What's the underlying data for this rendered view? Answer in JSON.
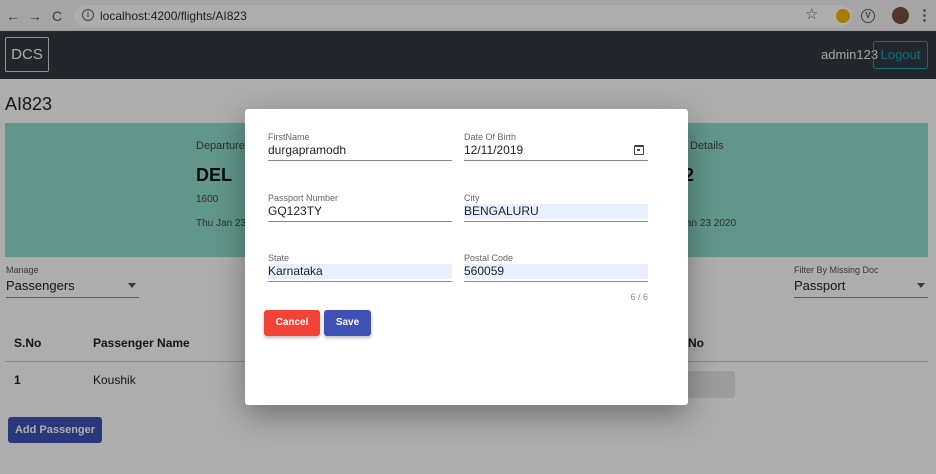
{
  "browser": {
    "url": "localhost:4200/flights/AI823",
    "back_icon": "←",
    "forward_icon": "→",
    "reload_icon": "C",
    "info_icon": "i",
    "star_icon": "☆",
    "ext_icon": "V",
    "menu_icon": "⋮"
  },
  "header": {
    "brand": "DCS",
    "username": "admin123",
    "logout_label": "Logout",
    "background": "#343a40",
    "logout_color": "#17a2b8"
  },
  "page": {
    "flight_title": "AI823",
    "card_color": "#8fdecc",
    "departure": {
      "label": "Departure",
      "code": "DEL",
      "time": "1600",
      "date": "Thu Jan 23"
    },
    "arrival": {
      "label": "Details",
      "code": "2",
      "date": "an 23 2020"
    },
    "manage": {
      "label": "Manage",
      "value": "Passengers"
    },
    "filter": {
      "label": "Filter By Missing Doc",
      "value": "Passport"
    },
    "table": {
      "headers": [
        "S.No",
        "Passenger Name",
        "No"
      ],
      "rows": [
        {
          "sno": "1",
          "name": "Koushik"
        }
      ]
    },
    "add_passenger_label": "Add Passenger"
  },
  "modal": {
    "first_name": {
      "label": "FirstName",
      "value": "durgapramodh"
    },
    "dob": {
      "label": "Date Of Birth",
      "value": "12/11/2019"
    },
    "passport": {
      "label": "Passport Number",
      "value": "GQ123TY"
    },
    "city": {
      "label": "City",
      "value": "BENGALURU"
    },
    "state": {
      "label": "State",
      "value": "Karnataka"
    },
    "postal": {
      "label": "Postal Code",
      "value": "560059",
      "counter": "6 / 6"
    },
    "cancel_label": "Cancel",
    "save_label": "Save",
    "cancel_color": "#f44336",
    "save_color": "#3f51b5"
  }
}
